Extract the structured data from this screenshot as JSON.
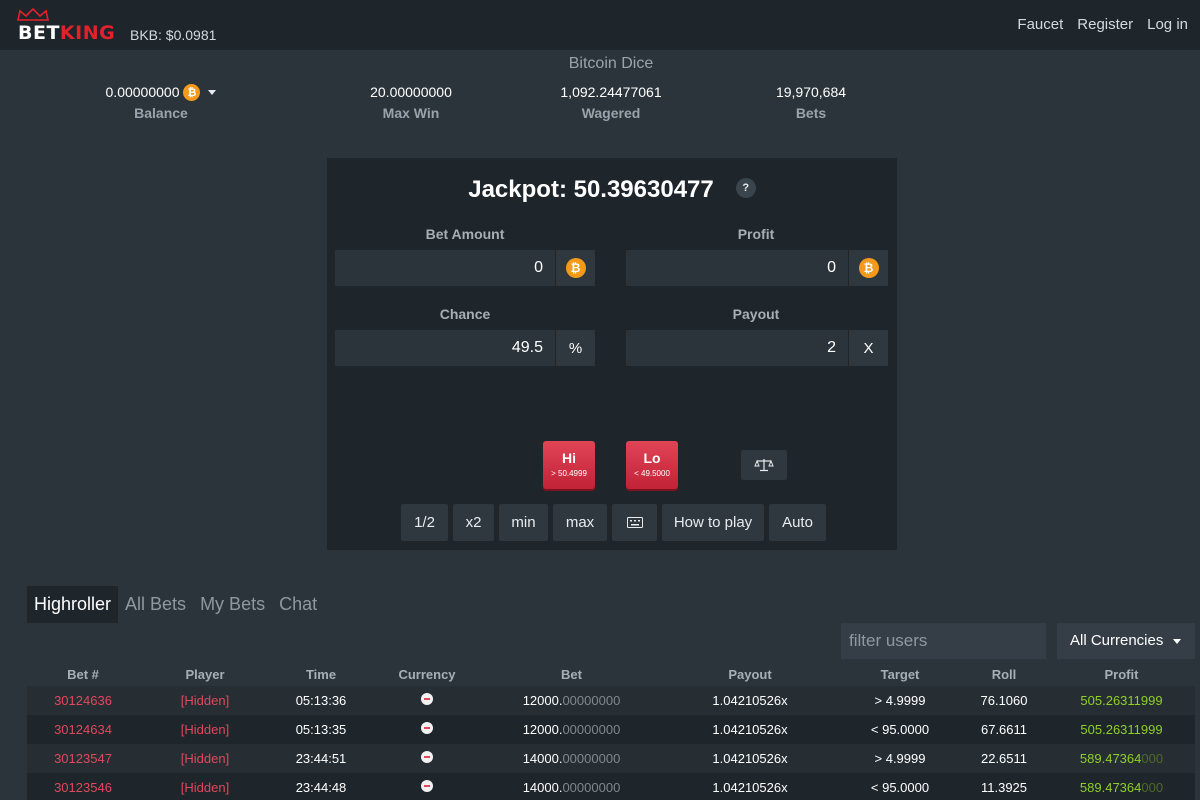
{
  "nav": {
    "brand_a": "BET",
    "brand_b": "KING",
    "bkb_price": "BKB: $0.0981",
    "links": [
      "Faucet",
      "Register",
      "Log in"
    ]
  },
  "game": {
    "title": "Bitcoin Dice",
    "stats": [
      {
        "value": "0.00000000",
        "label": "Balance"
      },
      {
        "value": "20.00000000",
        "label": "Max Win"
      },
      {
        "value": "1,092.24477061",
        "label": "Wagered"
      },
      {
        "value": "19,970,684",
        "label": "Bets"
      }
    ]
  },
  "panel": {
    "jackpot": "Jackpot: 50.39630477",
    "help": "?",
    "bet_amount_label": "Bet Amount",
    "bet_amount_value": "0",
    "profit_label": "Profit",
    "profit_value": "0",
    "chance_label": "Chance",
    "chance_value": "49.5",
    "chance_unit": "%",
    "payout_label": "Payout",
    "payout_value": "2",
    "payout_unit": "X",
    "hi_label": "Hi",
    "hi_sub": "> 50.4999",
    "lo_label": "Lo",
    "lo_sub": "< 49.5000",
    "toolbar": [
      "1/2",
      "x2",
      "min",
      "max",
      "",
      "How to play",
      "Auto"
    ]
  },
  "tabs": [
    "Highroller",
    "All Bets",
    "My Bets",
    "Chat"
  ],
  "filter_placeholder": "filter users",
  "currency_select": "All Currencies",
  "table": {
    "headers": [
      "Bet #",
      "Player",
      "Time",
      "Currency",
      "Bet",
      "Payout",
      "Target",
      "Roll",
      "Profit"
    ],
    "rows": [
      {
        "bet_no": "30124636",
        "player": "[Hidden]",
        "time": "05:13:36",
        "bet_int": "12000.",
        "bet_dec": "00000000",
        "payout": "1.04210526x",
        "target": "> 4.9999",
        "roll": "76.1060",
        "profit_main": "505.26311999",
        "profit_dim": ""
      },
      {
        "bet_no": "30124634",
        "player": "[Hidden]",
        "time": "05:13:35",
        "bet_int": "12000.",
        "bet_dec": "00000000",
        "payout": "1.04210526x",
        "target": "< 95.0000",
        "roll": "67.6611",
        "profit_main": "505.26311999",
        "profit_dim": ""
      },
      {
        "bet_no": "30123547",
        "player": "[Hidden]",
        "time": "23:44:51",
        "bet_int": "14000.",
        "bet_dec": "00000000",
        "payout": "1.04210526x",
        "target": "> 4.9999",
        "roll": "22.6511",
        "profit_main": "589.47364",
        "profit_dim": "000"
      },
      {
        "bet_no": "30123546",
        "player": "[Hidden]",
        "time": "23:44:48",
        "bet_int": "14000.",
        "bet_dec": "00000000",
        "payout": "1.04210526x",
        "target": "< 95.0000",
        "roll": "11.3925",
        "profit_main": "589.47364",
        "profit_dim": "000"
      }
    ]
  },
  "colors": {
    "accent_red": "#e0485c",
    "btc_orange": "#f39a1b",
    "profit_green": "#8fcf27"
  }
}
